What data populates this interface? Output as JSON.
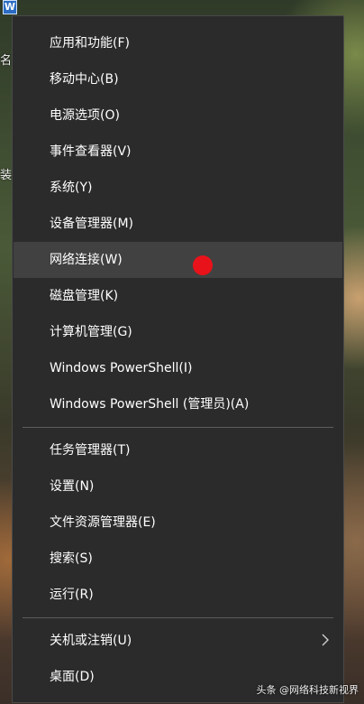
{
  "desktop": {
    "icon_label": "W",
    "text_fragment_1": "名",
    "text_fragment_2": "装"
  },
  "menu": {
    "group1": [
      "应用和功能(F)",
      "移动中心(B)",
      "电源选项(O)",
      "事件查看器(V)",
      "系统(Y)",
      "设备管理器(M)",
      "网络连接(W)",
      "磁盘管理(K)",
      "计算机管理(G)",
      "Windows PowerShell(I)",
      "Windows PowerShell (管理员)(A)"
    ],
    "group2": [
      "任务管理器(T)",
      "设置(N)",
      "文件资源管理器(E)",
      "搜索(S)",
      "运行(R)"
    ],
    "group3": [
      "关机或注销(U)",
      "桌面(D)"
    ],
    "highlighted_item": "网络连接(W)"
  },
  "colors": {
    "menu_background": "#2b2b2b",
    "hover_background": "#414141",
    "text": "#ffffff",
    "marker": "#e8121a"
  },
  "watermark": "头条 @网络科技新视界"
}
